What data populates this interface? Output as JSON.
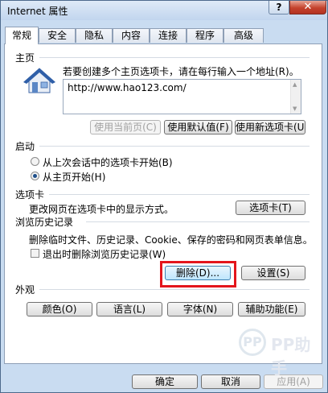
{
  "window": {
    "title": "Internet 属性",
    "help_label": "?",
    "close_label": "✕"
  },
  "tabs": [
    "常规",
    "安全",
    "隐私",
    "内容",
    "连接",
    "程序",
    "高级"
  ],
  "home": {
    "section": "主页",
    "description": "若要创建多个主页选项卡，请在每行输入一个地址(R)。",
    "url": "http://www.hao123.com/",
    "btn_current": "使用当前页(C)",
    "btn_default": "使用默认值(F)",
    "btn_newtab": "使用新选项卡(U)"
  },
  "startup": {
    "section": "启动",
    "option1": "从上次会话中的选项卡开始(B)",
    "option2": "从主页开始(H)"
  },
  "tabs_section": {
    "section": "选项卡",
    "description": "更改网页在选项卡中的显示方式。",
    "button": "选项卡(T)"
  },
  "history": {
    "section": "浏览历史记录",
    "description": "删除临时文件、历史记录、Cookie、保存的密码和网页表单信息。",
    "checkbox_label": "退出时删除浏览历史记录(W)",
    "delete_button": "删除(D)...",
    "settings_button": "设置(S)"
  },
  "appearance": {
    "section": "外观",
    "colors": "颜色(O)",
    "languages": "语言(L)",
    "fonts": "字体(N)",
    "accessibility": "辅助功能(E)"
  },
  "footer": {
    "ok": "确定",
    "cancel": "取消",
    "apply": "应用(A)"
  },
  "watermark": {
    "logo": "PP",
    "text": "PP助手"
  },
  "colors": {
    "highlight": "#e4151c",
    "window_frame": "#c9dcf1"
  }
}
